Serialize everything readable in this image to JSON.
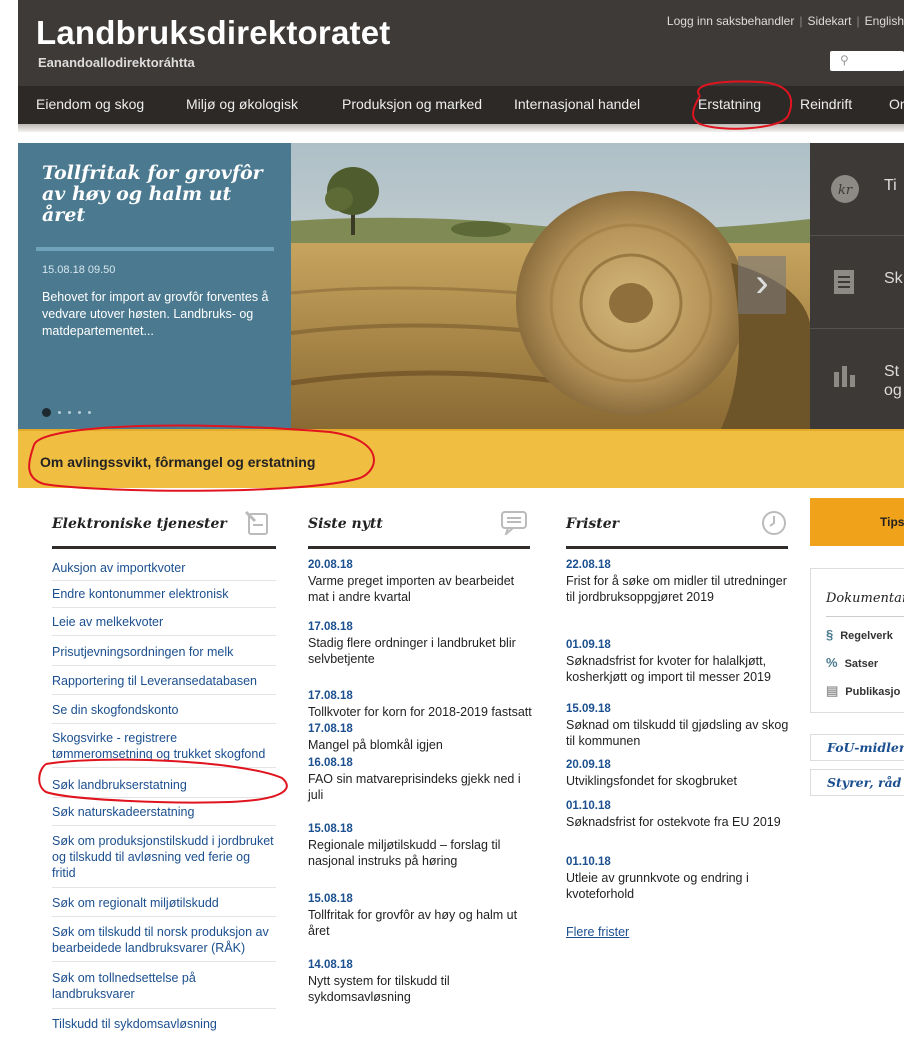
{
  "site": {
    "title": "Landbruksdirektoratet",
    "subtitle": "Eanandoallodirektoráhtta"
  },
  "top_links": [
    "Logg inn saksbehandler",
    "Sidekart",
    "English"
  ],
  "nav": [
    "Eiendom og skog",
    "Miljø og økologisk",
    "Produksjon og marked",
    "Internasjonal handel",
    "Erstatning",
    "Reindrift",
    "Or"
  ],
  "hero": {
    "title": "Tollfritak for grovfôr av høy og halm ut året",
    "date": "15.08.18 09.50",
    "text": "Behovet for import av grovfôr forventes å vedvare utover høsten. Landbruks- og matdepartementet...",
    "slides": 5,
    "active_slide": 1
  },
  "hero_side": [
    {
      "icon": "kr-icon",
      "label": "Ti"
    },
    {
      "icon": "document-icon",
      "label": "Sk"
    },
    {
      "icon": "bar-chart-icon",
      "label": "St og"
    }
  ],
  "banner": "Om avlingssvikt, fôrmangel og erstatning",
  "e_services": {
    "heading": "Elektroniske tjenester",
    "items": [
      "Auksjon av importkvoter",
      "Endre kontonummer elektronisk",
      "Leie av melkekvoter",
      "Prisutjevningsordningen for melk",
      "Rapportering til Leveransedatabasen",
      "Se din skogfondskonto",
      "Skogsvirke - registrere tømmeromsetning og trukket skogfond",
      "Søk landbrukserstatning",
      "Søk naturskadeerstatning",
      "Søk om produksjonstilskudd i jordbruket og tilskudd til avløsning ved ferie og fritid",
      "Søk om regionalt miljøtilskudd",
      "Søk om tilskudd til norsk produksjon av bearbeidede landbruksvarer (RÅK)",
      "Søk om tollnedsettelse på landbruksvarer",
      "Tilskudd til sykdomsavløsning"
    ]
  },
  "news": {
    "heading": "Siste nytt",
    "items": [
      {
        "date": "20.08.18",
        "title": "Varme preget importen av bearbeidet mat i andre kvartal"
      },
      {
        "date": "17.08.18",
        "title": "Stadig flere ordninger i landbruket blir selvbetjente"
      },
      {
        "date": "17.08.18",
        "title": "Tollkvoter for korn for 2018-2019 fastsatt"
      },
      {
        "date": "17.08.18",
        "title": "Mangel på blomkål igjen"
      },
      {
        "date": "16.08.18",
        "title": "FAO sin matvareprisindeks gjekk ned i juli"
      },
      {
        "date": "15.08.18",
        "title": "Regionale miljøtilskudd – forslag til nasjonal instruks på høring"
      },
      {
        "date": "15.08.18",
        "title": "Tollfritak for grovfôr av høy og halm ut året"
      },
      {
        "date": "14.08.18",
        "title": "Nytt system for tilskudd til sykdomsavløsning"
      }
    ]
  },
  "deadlines": {
    "heading": "Frister",
    "items": [
      {
        "date": "22.08.18",
        "title": "Frist for å søke om midler til utredninger til jordbruksoppgjøret 2019"
      },
      {
        "date": "01.09.18",
        "title": "Søknadsfrist for kvoter for halalkjøtt, kosherkjøtt og import til messer 2019"
      },
      {
        "date": "15.09.18",
        "title": "Søknad om tilskudd til gjødsling av skog til kommunen"
      },
      {
        "date": "20.09.18",
        "title": "Utviklingsfondet for skogbruket"
      },
      {
        "date": "01.10.18",
        "title": "Søknadsfrist for ostekvote fra EU 2019"
      },
      {
        "date": "01.10.18",
        "title": "Utleie av grunnkvote og endring i kvoteforhold"
      }
    ],
    "more": "Flere frister"
  },
  "sidebar": {
    "tips": "Tips",
    "documentation_heading": "Dokumentar",
    "doc_items": [
      {
        "icon": "§",
        "label": "Regelverk"
      },
      {
        "icon": "%",
        "label": "Satser"
      },
      {
        "icon": "▤",
        "label": "Publikasjo"
      }
    ],
    "links": [
      "FoU-midler",
      "Styrer, råd"
    ]
  },
  "colors": {
    "header_bg": "#3e3a37",
    "nav_bg": "#2c2927",
    "hero_panel": "#4b7a90",
    "banner": "#f0be41",
    "link": "#1b4f8f",
    "annotation": "#e0141e"
  }
}
